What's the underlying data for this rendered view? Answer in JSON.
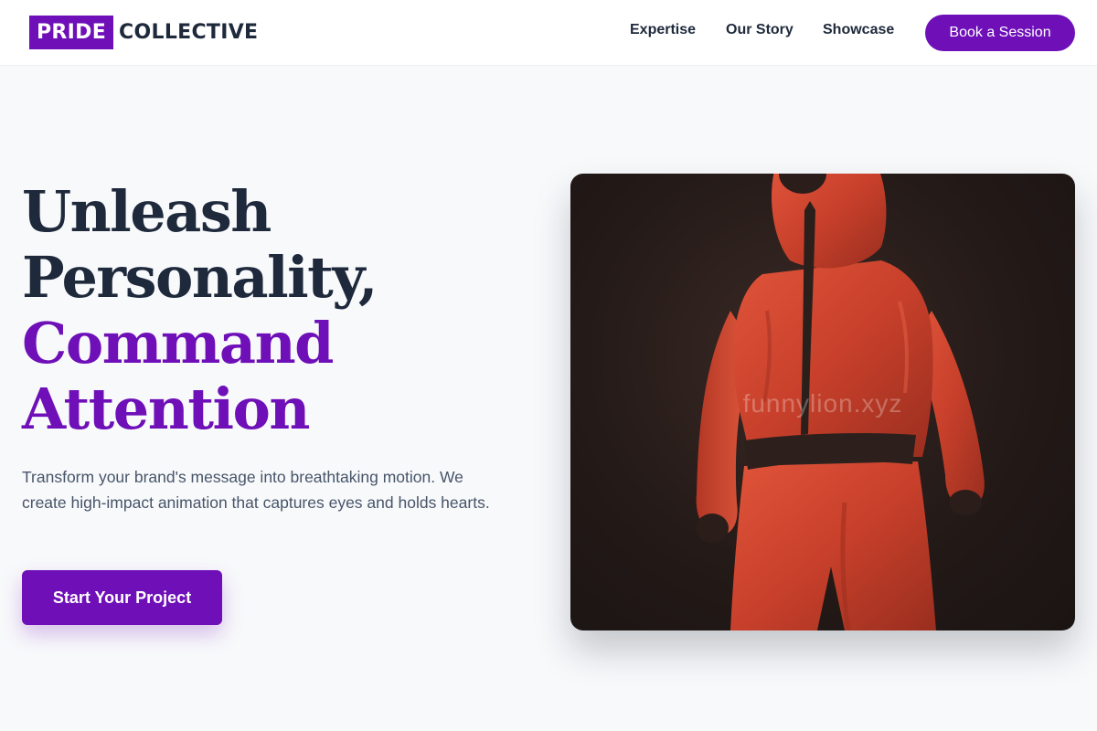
{
  "brand": {
    "logo_highlight": "PRIDE",
    "logo_rest": "COLLECTIVE",
    "accent_color": "#6e0fb8"
  },
  "nav": {
    "links": [
      "Expertise",
      "Our Story",
      "Showcase"
    ],
    "cta_label": "Book a Session"
  },
  "hero": {
    "title_line1": "Unleash",
    "title_line2": "Personality,",
    "title_line3": "Command",
    "title_line4": "Attention",
    "subtitle": "Transform your brand's message into breathtaking motion. We create high-impact animation that captures eyes and holds hearts.",
    "button_label": "Start Your Project",
    "image_watermark": "funnylion.xyz"
  }
}
